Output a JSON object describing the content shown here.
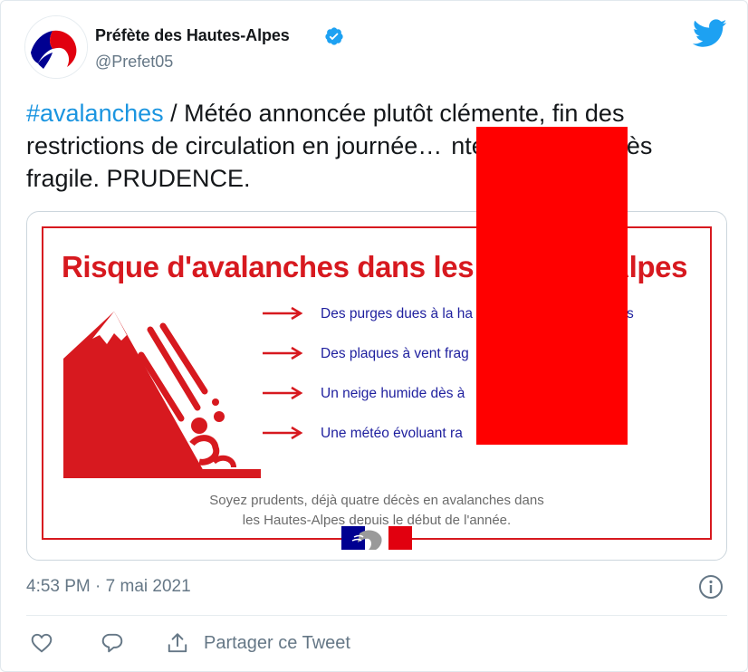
{
  "author": {
    "name": "Préfète des Hautes-Alpes",
    "handle": "@Prefet05",
    "verified": true,
    "avatar_icon": "marianne-logo-icon"
  },
  "tweet": {
    "hashtag": "#avalanches",
    "text_rest": " / Météo annoncée plutôt clémente, fin des restrictions de circulation en journée…",
    "text_tail": "nteau neigeux très fragile. PRUDENCE."
  },
  "media": {
    "title_left": "Risque d'avalanches dans les",
    "title_right": "Alpes",
    "bullets": [
      "Des purges dues à la ha",
      "Des plaques à vent frag",
      "Un neige humide dès à",
      "Une météo évoluant ra"
    ],
    "bullet_suffix_first": "s",
    "caption_line1": "Soyez prudents, déjà quatre décès en avalanches dans",
    "caption_line2": "les Hautes-Alpes depuis le début de l'année."
  },
  "meta": {
    "timestamp": "4:53 PM · 7 mai 2021"
  },
  "actions": {
    "share_label": "Partager ce Tweet"
  },
  "colors": {
    "brand_blue": "#1da1f2",
    "hashtag_blue": "#1b95e0",
    "alert_red": "#d7191f",
    "redaction": "#ff0000",
    "bullet_text": "#1e1f9e"
  }
}
